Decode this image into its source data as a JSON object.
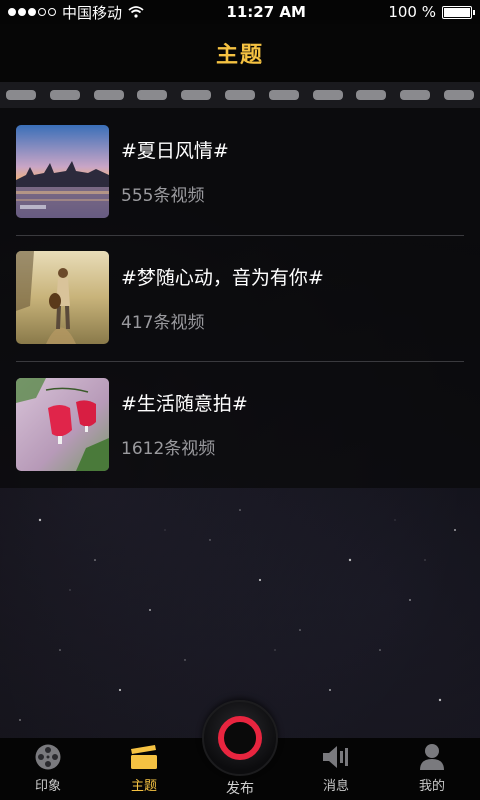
{
  "status_bar": {
    "carrier": "中国移动",
    "time": "11:27 AM",
    "battery": "100 %"
  },
  "nav": {
    "title": "主题"
  },
  "topics": [
    {
      "title": "#夏日风情#",
      "count": "555条视频",
      "thumb": "city-sunset-image"
    },
    {
      "title": "#梦随心动，音为有你#",
      "count": "417条视频",
      "thumb": "guitar-girl-image"
    },
    {
      "title": "#生活随意拍#",
      "count": "1612条视频",
      "thumb": "red-flower-image"
    }
  ],
  "tab_bar": {
    "tabs": [
      {
        "label": "印象",
        "icon": "film-reel-icon",
        "active": false
      },
      {
        "label": "主题",
        "icon": "clapperboard-icon",
        "active": true
      },
      {
        "label": "消息",
        "icon": "speaker-icon",
        "active": false
      },
      {
        "label": "我的",
        "icon": "user-icon",
        "active": false
      }
    ],
    "publish_label": "发布"
  },
  "colors": {
    "accent": "#f5c242",
    "record": "#e8253f"
  }
}
